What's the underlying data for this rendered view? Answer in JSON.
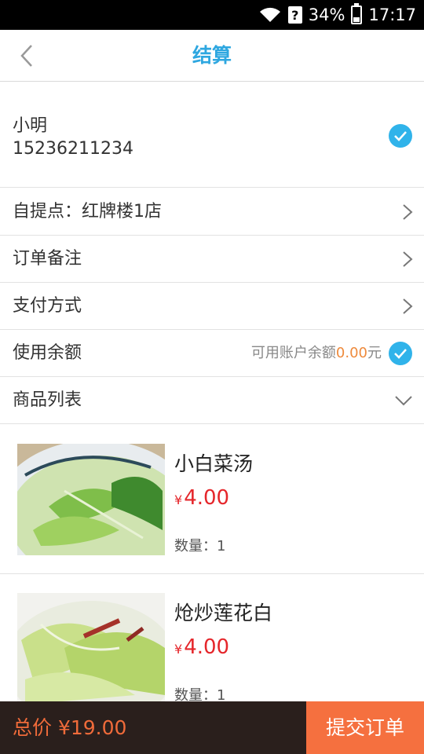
{
  "status_bar": {
    "battery": "34%",
    "time": "17:17",
    "sim": "?"
  },
  "header": {
    "title": "结算"
  },
  "address": {
    "name": "小明",
    "phone": "15236211234"
  },
  "rows": {
    "pickup": {
      "label": "自提点：红牌楼1店"
    },
    "remark": {
      "label": "订单备注"
    },
    "payment": {
      "label": "支付方式"
    },
    "balance": {
      "label": "使用余额",
      "hint": "可用账户余额",
      "amount": "0.00",
      "unit": "元"
    },
    "products_header": {
      "label": "商品列表"
    }
  },
  "products": [
    {
      "name": "小白菜汤",
      "currency": "¥",
      "price": "4.00",
      "qty_label": "数量：1"
    },
    {
      "name": "炝炒莲花白",
      "currency": "¥",
      "price": "4.00",
      "qty_label": "数量：1"
    }
  ],
  "bottom": {
    "total_label": "总价 ¥19.00",
    "submit_label": "提交订单"
  },
  "colors": {
    "accent": "#2ea7e0",
    "check": "#30b3ea",
    "price": "#e5262b",
    "submit": "#f5703f",
    "total": "#f06b3a",
    "bar": "#2a1f1c"
  },
  "icons": [
    "back-arrow-icon",
    "wifi-icon",
    "check-circle-icon",
    "chevron-right-icon",
    "chevron-down-icon"
  ]
}
